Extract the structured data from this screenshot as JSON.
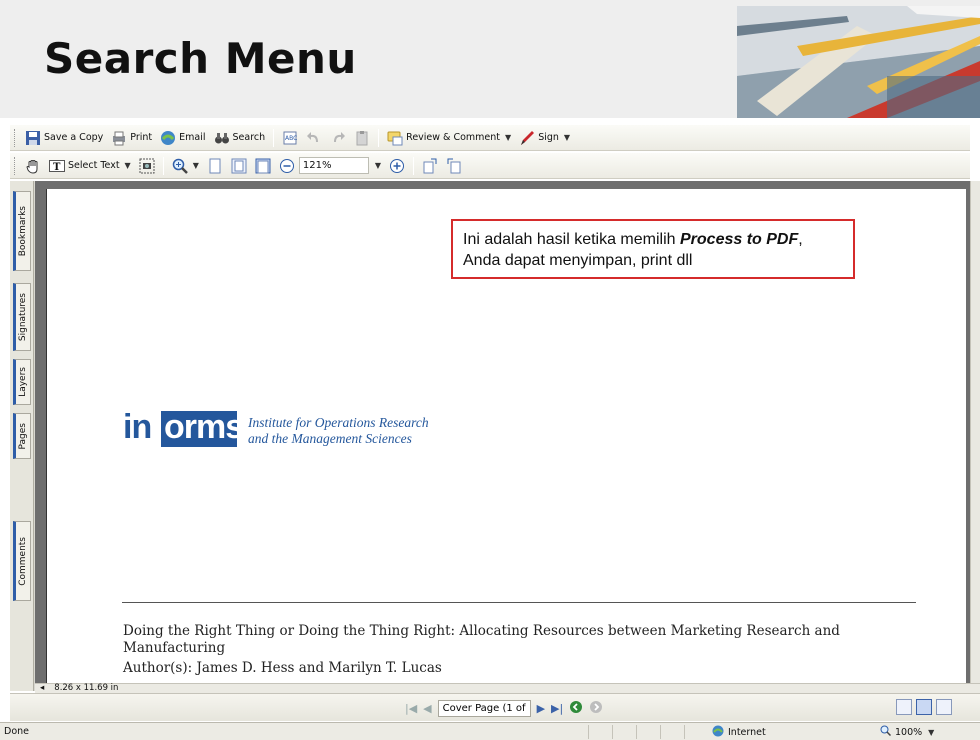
{
  "slide": {
    "title": "Search Menu"
  },
  "toolbar1": {
    "save_copy": "Save a Copy",
    "print": "Print",
    "email": "Email",
    "search": "Search",
    "review_comment": "Review & Comment",
    "sign": "Sign"
  },
  "toolbar2": {
    "select_text": "Select Text",
    "zoom_value": "121%"
  },
  "side_tabs": [
    "Bookmarks",
    "Signatures",
    "Layers",
    "Pages",
    "Comments"
  ],
  "callout": {
    "text_before": "Ini adalah hasil ketika memilih ",
    "text_bold": "Process to PDF",
    "text_after": ", Anda dapat menyimpan, print dll"
  },
  "document": {
    "logo_in": "in",
    "logo_orms": "orms",
    "tagline_line1": "Institute for Operations Research",
    "tagline_line2": "and the Management Sciences",
    "paper_title": "Doing the Right Thing or Doing the Thing Right: Allocating Resources between Marketing Research and Manufacturing",
    "paper_author": "Author(s): James D. Hess and Marilyn T. Lucas"
  },
  "page_size": "8.26 x 11.69 in",
  "navigation": {
    "page_field": "Cover Page  (1 of"
  },
  "status": {
    "left": "Done",
    "zone": "Internet",
    "zoom": "100%"
  },
  "colors": {
    "callout_border": "#d52b2b",
    "informs_blue": "#24579c"
  }
}
